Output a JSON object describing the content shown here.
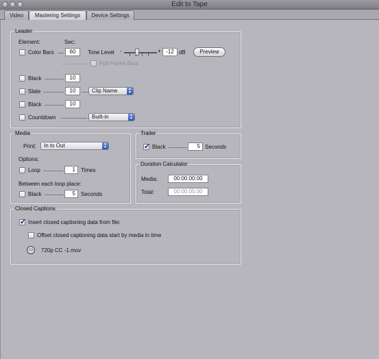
{
  "window": {
    "title": "Edit to Tape"
  },
  "tabs": [
    {
      "label": "Video"
    },
    {
      "label": "Mastering Settings"
    },
    {
      "label": "Device Settings"
    }
  ],
  "leader": {
    "title": "Leader",
    "element_header": "Element:",
    "sec_header": "Sec:",
    "color_bars": {
      "label": "Color Bars",
      "seconds": "60",
      "checked": false
    },
    "tone_level": {
      "label": "Tone Level",
      "value": "-12",
      "unit": "dB",
      "minus_glyph": "-",
      "plus_glyph": "+"
    },
    "preview_button": "Preview",
    "full_frame_bars": {
      "label": "Full Frame Bars",
      "checked": false,
      "enabled": false
    },
    "black1": {
      "label": "Black",
      "seconds": "10",
      "checked": false
    },
    "slate": {
      "label": "Slate",
      "seconds": "10",
      "checked": false,
      "source": "Clip Name"
    },
    "black2": {
      "label": "Black",
      "seconds": "10",
      "checked": false
    },
    "countdown": {
      "label": "Countdown",
      "checked": false,
      "type": "Built-in"
    }
  },
  "media": {
    "title": "Media",
    "print_label": "Print:",
    "print_value": "In to Out",
    "options_label": "Options:",
    "loop": {
      "label": "Loop",
      "value": "1",
      "unit": "Times",
      "checked": false
    },
    "between_label": "Between each loop place:",
    "black": {
      "label": "Black",
      "value": "5",
      "unit": "Seconds",
      "checked": false
    }
  },
  "trailer": {
    "title": "Trailer",
    "black": {
      "label": "Black",
      "value": "5",
      "unit": "Seconds",
      "checked": true
    }
  },
  "duration": {
    "title": "Duration Calculator",
    "media_label": "Media:",
    "media_value": "00:00:00:00",
    "total_label": "Total:",
    "total_value": "00:00:05:00"
  },
  "closed_captions": {
    "title": "Closed Captions",
    "insert": {
      "label": "Insert closed captioning data from file:",
      "checked": true
    },
    "offset": {
      "label": "Offset closed captioning data start by media in time",
      "checked": false
    },
    "file": "720p CC -1.mov"
  },
  "colors": {
    "accent": "#2f58b7",
    "background": "#b7b6bd"
  }
}
